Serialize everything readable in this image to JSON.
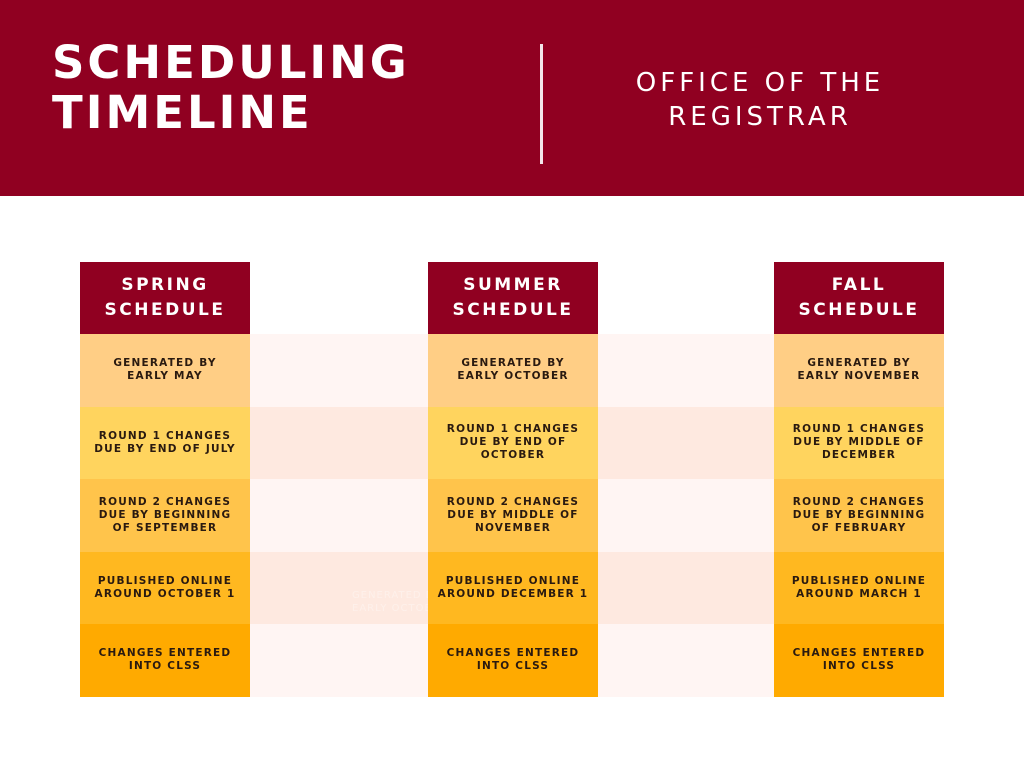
{
  "header": {
    "title_lines": [
      "SCHEDULING",
      "TIMELINE"
    ],
    "subtitle_lines": [
      "OFFICE OF THE",
      "REGISTRAR"
    ]
  },
  "colors": {
    "brand": "#900021",
    "row_colors": [
      "#ffce85",
      "#ffd45e",
      "#ffc44b",
      "#ffb820",
      "#ffaa00"
    ],
    "stripe_light": "#fff5f3",
    "stripe_dark": "#fee9e0"
  },
  "ghost_text": [
    "GENERATED BY",
    "EARLY OCTOBER"
  ],
  "columns": [
    {
      "header_lines": [
        "SPRING",
        "SCHEDULE"
      ],
      "steps": [
        "GENERATED BY\nEARLY MAY",
        "ROUND 1 CHANGES\nDUE BY END OF JULY",
        "ROUND 2 CHANGES\nDUE BY BEGINNING\nOF SEPTEMBER",
        "PUBLISHED ONLINE\nAROUND OCTOBER 1",
        "CHANGES ENTERED\nINTO CLSS"
      ]
    },
    {
      "header_lines": [
        "SUMMER",
        "SCHEDULE"
      ],
      "steps": [
        "GENERATED BY\nEARLY OCTOBER",
        "ROUND 1 CHANGES\nDUE BY END OF\nOCTOBER",
        "ROUND 2 CHANGES\nDUE BY MIDDLE OF\nNOVEMBER",
        "PUBLISHED ONLINE\nAROUND DECEMBER 1",
        "CHANGES ENTERED\nINTO CLSS"
      ]
    },
    {
      "header_lines": [
        "FALL",
        "SCHEDULE"
      ],
      "steps": [
        "GENERATED BY\nEARLY NOVEMBER",
        "ROUND 1 CHANGES\nDUE BY MIDDLE OF\nDECEMBER",
        "ROUND 2 CHANGES\nDUE BY BEGINNING\nOF FEBRUARY",
        "PUBLISHED ONLINE\nAROUND MARCH 1",
        "CHANGES ENTERED\nINTO CLSS"
      ]
    }
  ]
}
